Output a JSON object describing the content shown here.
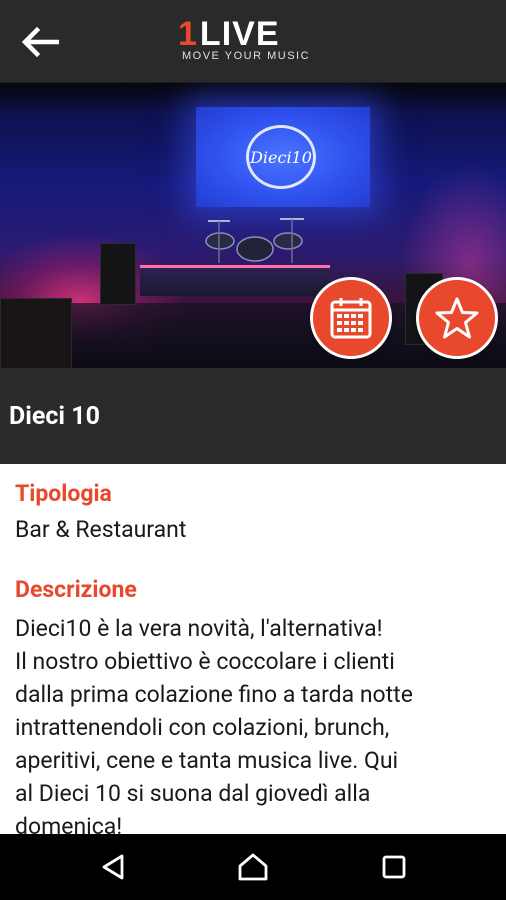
{
  "header": {
    "logo_one": "1",
    "logo_live": "LIVE",
    "logo_tagline": "MOVE YOUR MUSIC"
  },
  "hero": {
    "screen_logo_text": "Dieci10"
  },
  "venue": {
    "title": "Dieci 10"
  },
  "details": {
    "type_label": "Tipologia",
    "type_value": "Bar & Restaurant",
    "description_label": "Descrizione",
    "description_lines": [
      "Dieci10 è la vera novità, l'alternativa!",
      "Il nostro obiettivo è coccolare i clienti",
      "dalla prima colazione fino a tarda notte",
      "intrattenendoli con colazioni, brunch,",
      "aperitivi, cene e tanta musica live. Qui",
      "al Dieci 10 si suona dal giovedì alla",
      "domenica!"
    ]
  },
  "icons": {
    "back": "arrow-left-icon",
    "calendar": "calendar-icon",
    "favorite": "star-icon",
    "nav_back": "triangle-back-icon",
    "nav_home": "home-icon",
    "nav_recents": "square-recents-icon"
  },
  "colors": {
    "accent": "#e8482b",
    "bar_bg": "#2b2a2a",
    "nav_bg": "#000000"
  }
}
